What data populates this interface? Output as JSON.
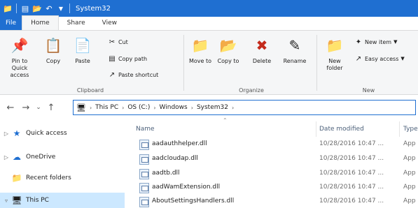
{
  "titlebar": {
    "title": "System32",
    "qa_icons": [
      "folder-icon",
      "properties-icon",
      "new-folder-icon",
      "undo-icon"
    ]
  },
  "tabs": [
    "File",
    "Home",
    "Share",
    "View"
  ],
  "ribbon": {
    "clipboard": {
      "label": "Clipboard",
      "pin_label": "Pin to Quick access",
      "copy_label": "Copy",
      "paste_label": "Paste",
      "cut_label": "Cut",
      "copy_path_label": "Copy path",
      "paste_shortcut_label": "Paste shortcut"
    },
    "organize": {
      "label": "Organize",
      "move_to_label": "Move to",
      "copy_to_label": "Copy to",
      "delete_label": "Delete",
      "rename_label": "Rename"
    },
    "new": {
      "label": "New",
      "new_folder_label": "New folder",
      "new_item_label": "New item",
      "easy_access_label": "Easy access"
    }
  },
  "address": {
    "crumbs": [
      "This PC",
      "OS (C:)",
      "Windows",
      "System32"
    ]
  },
  "navpane": {
    "items": [
      {
        "label": "Quick access",
        "icon": "star-icon"
      },
      {
        "label": "OneDrive",
        "icon": "cloud-icon"
      },
      {
        "label": "Recent folders",
        "icon": "recent-folders-icon"
      },
      {
        "label": "This PC",
        "icon": "computer-icon"
      }
    ]
  },
  "filelist": {
    "columns": {
      "name": "Name",
      "date": "Date modified",
      "type": "Type"
    },
    "rows": [
      {
        "name": "aadauthhelper.dll",
        "date": "10/28/2016 10:47 ...",
        "type": "App"
      },
      {
        "name": "aadcloudap.dll",
        "date": "10/28/2016 10:47 ...",
        "type": "App"
      },
      {
        "name": "aadtb.dll",
        "date": "10/28/2016 10:47 ...",
        "type": "App"
      },
      {
        "name": "aadWamExtension.dll",
        "date": "10/28/2016 10:47 ...",
        "type": "App"
      },
      {
        "name": "AboutSettingsHandlers.dll",
        "date": "10/28/2016 10:47 ...",
        "type": "App"
      }
    ]
  }
}
